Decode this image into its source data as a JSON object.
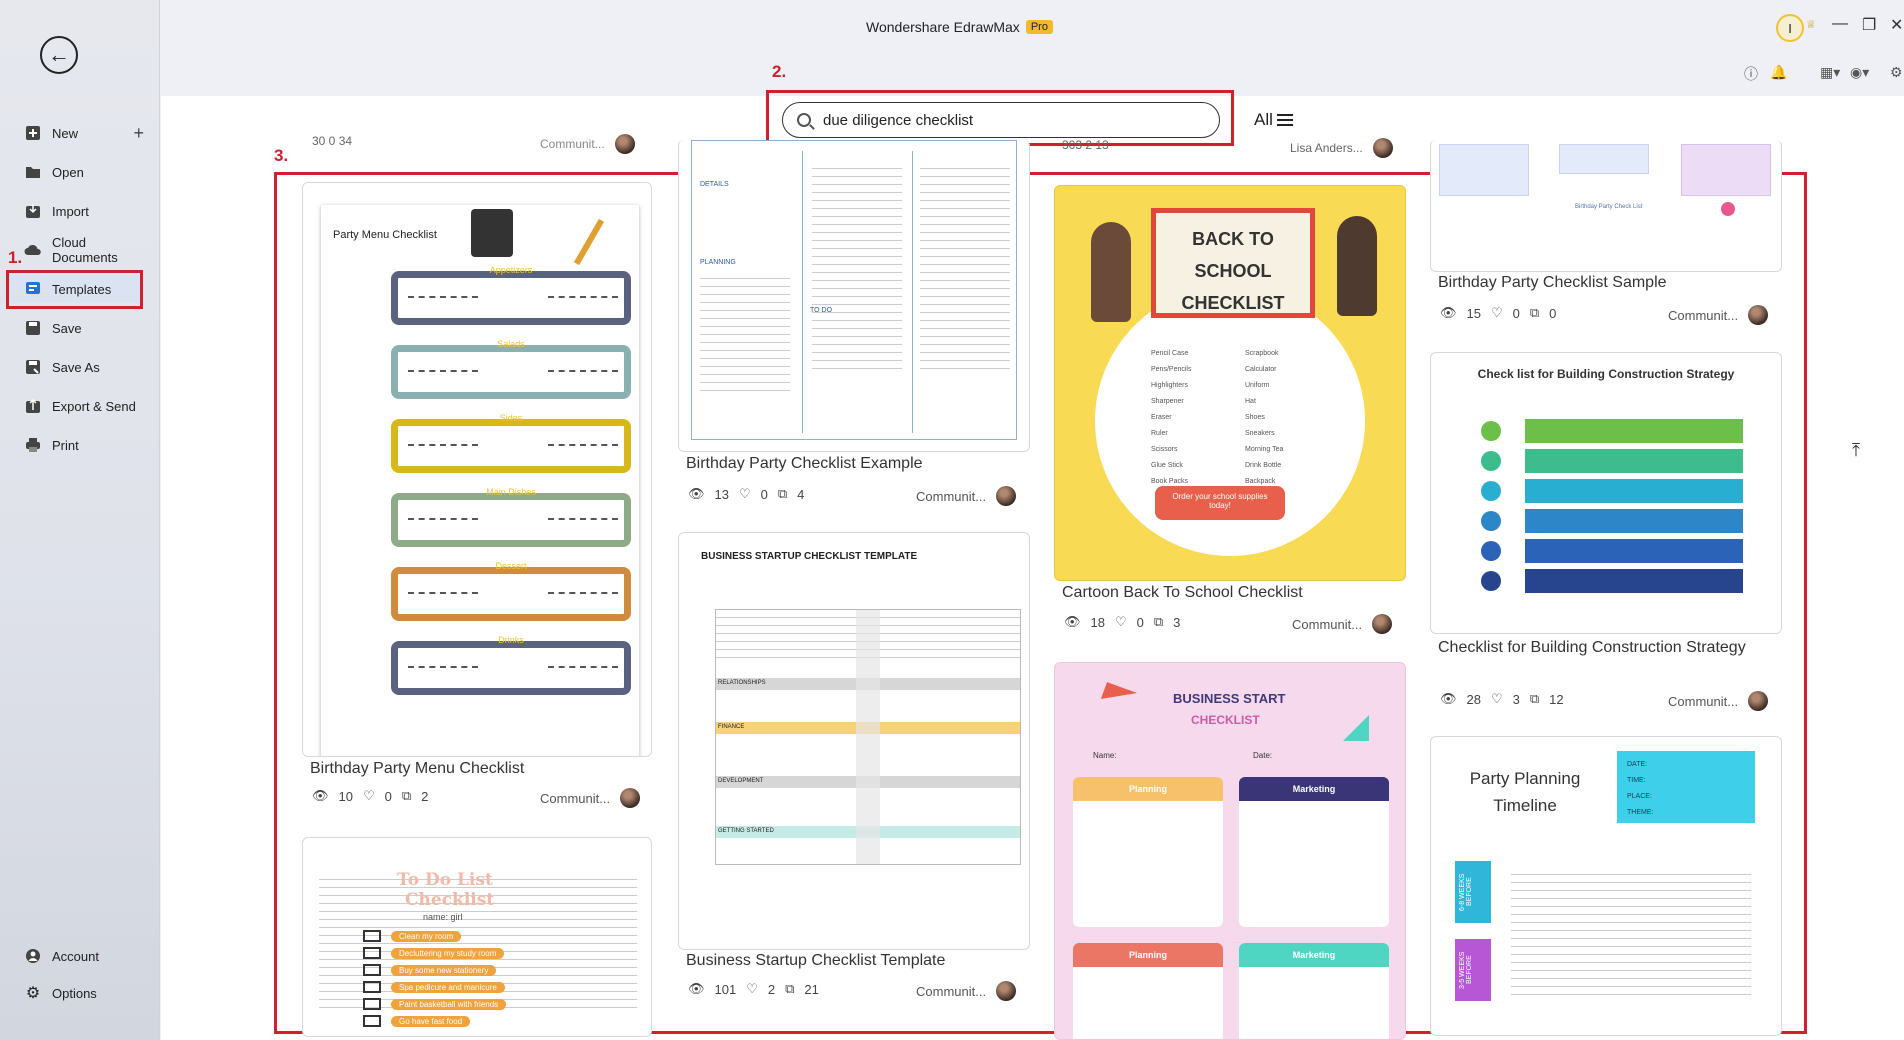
{
  "app": {
    "title": "Wondershare EdrawMax",
    "badge": "Pro",
    "user_initial": "I"
  },
  "sidebar": {
    "items": [
      {
        "label": "New",
        "icon": "new-icon"
      },
      {
        "label": "Open",
        "icon": "folder-icon"
      },
      {
        "label": "Import",
        "icon": "import-icon"
      },
      {
        "label": "Cloud Documents",
        "icon": "cloud-icon"
      },
      {
        "label": "Templates",
        "icon": "templates-icon"
      },
      {
        "label": "Save",
        "icon": "save-icon"
      },
      {
        "label": "Save As",
        "icon": "save-as-icon"
      },
      {
        "label": "Export & Send",
        "icon": "export-icon"
      },
      {
        "label": "Print",
        "icon": "print-icon"
      }
    ],
    "bottom": [
      {
        "label": "Account",
        "icon": "account-icon"
      },
      {
        "label": "Options",
        "icon": "gear-icon"
      }
    ]
  },
  "annotations": {
    "step1": "1.",
    "step2": "2.",
    "step3": "3."
  },
  "search": {
    "value": "due diligence checklist",
    "filter_label": "All"
  },
  "partial_top": {
    "col1_stats": "30  0  34",
    "col1_author": "Communit...",
    "col3_stats": "303  2  13",
    "col3_author": "Lisa Anders..."
  },
  "cards": [
    {
      "title": "Birthday Party Menu Checklist",
      "views": "10",
      "likes": "0",
      "copies": "2",
      "author": "Communit..."
    },
    {
      "title": "Birthday Party Checklist Example",
      "views": "13",
      "likes": "0",
      "copies": "4",
      "author": "Communit..."
    },
    {
      "title": "Business Startup Checklist Template",
      "views": "101",
      "likes": "2",
      "copies": "21",
      "author": "Communit..."
    },
    {
      "title": "Cartoon Back To School Checklist",
      "views": "18",
      "likes": "0",
      "copies": "3",
      "author": "Communit..."
    },
    {
      "title": "Birthday Party Checklist Sample",
      "views": "15",
      "likes": "0",
      "copies": "0",
      "author": "Communit..."
    },
    {
      "title": "Checklist for Building Construction Strategy",
      "views": "28",
      "likes": "3",
      "copies": "12",
      "author": "Communit..."
    }
  ],
  "thumbs": {
    "party_menu": {
      "heading": "Party Menu Checklist",
      "sections": [
        "Appetizers",
        "Salads",
        "Sides",
        "Main Dishes",
        "Dessert",
        "Drinks"
      ]
    },
    "bpc_example": {
      "details": "DETAILS",
      "planning": "PLANNING",
      "todo": "TO DO"
    },
    "startup": {
      "heading": "BUSINESS STARTUP CHECKLIST TEMPLATE",
      "bands": [
        "RELATIONSHIPS",
        "FINANCE",
        "DEVELOPMENT",
        "GETTING STARTED"
      ]
    },
    "school": {
      "heading": "BACK TO SCHOOL CHECKLIST",
      "cta": "Order your school supplies today!",
      "left": [
        "Pencil Case",
        "Pens/Pencils",
        "Highlighters",
        "Sharpener",
        "Eraser",
        "Ruler",
        "Scissors",
        "Glue Stick",
        "Book Packs"
      ],
      "right": [
        "Scrapbook",
        "Calculator",
        "Uniform",
        "Hat",
        "Shoes",
        "Sneakers",
        "Morning Tea",
        "Drink Bottle",
        "Backpack"
      ]
    },
    "business_start": {
      "heading": "BUSINESS START",
      "sub": "CHECKLIST",
      "name": "Name:",
      "date": "Date:",
      "col1": "Planning",
      "col2": "Marketing"
    },
    "todo": {
      "heading": "To Do List",
      "sub": "Checklist",
      "name": "name: girl",
      "items": [
        "Clean my room",
        "Decluttering my study room",
        "Buy some new stationery",
        "Spa pedicure and manicure",
        "Paint basketball with friends",
        "Go have fast food"
      ]
    },
    "construction": {
      "heading": "Check list for Building Construction Strategy"
    },
    "party_planning": {
      "heading": "Party Planning Timeline",
      "fields": [
        "DATE:",
        "TIME:",
        "PLACE:",
        "THEME:"
      ],
      "bands": [
        "6-8 WEEKS BEFORE",
        "3-5 WEEKS BEFORE"
      ]
    },
    "birthday_sample": {
      "caption": "Birthday Party Check List"
    }
  }
}
